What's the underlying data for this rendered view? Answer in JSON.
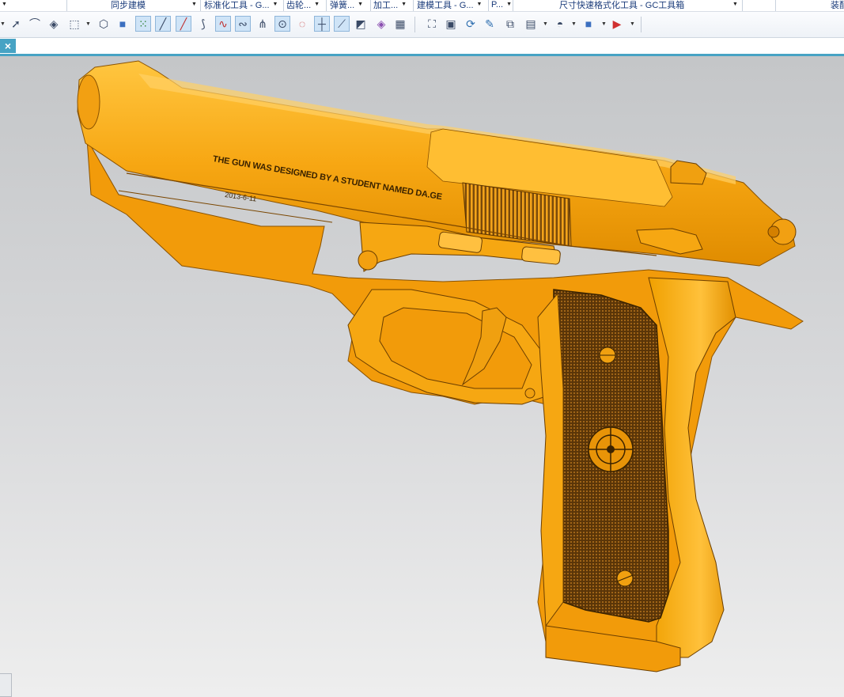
{
  "menu_groups": [
    {
      "label": "同步建模"
    },
    {
      "label": "标准化工具 - G..."
    },
    {
      "label": "齿轮..."
    },
    {
      "label": "弹簧..."
    },
    {
      "label": "加工..."
    },
    {
      "label": "建模工具 - G..."
    },
    {
      "label": "P..."
    },
    {
      "label": "尺寸快速格式化工具 - GC工具箱"
    },
    {
      "label": "装配"
    }
  ],
  "toolbar_icons": [
    "arrow-icon",
    "fillet-icon",
    "chamfer-icon",
    "shell-icon",
    "box-select-icon",
    "wireframe-icon",
    "shaded-icon",
    "point-snap-icon",
    "line-icon",
    "arc-icon",
    "curve-icon",
    "spline-icon",
    "wave-icon",
    "intersect-icon",
    "center-point-icon",
    "quadrant-icon",
    "cross-icon",
    "tangent-icon",
    "surface-icon",
    "mesh-icon",
    "table-icon",
    "view-fit-icon",
    "render-icon",
    "rotate-icon",
    "pen-icon",
    "section-icon",
    "layout-icon",
    "display-icon",
    "cube-view-icon",
    "filter-icon"
  ],
  "tab": {
    "close_label": "×"
  },
  "engraving": {
    "line1": "THE GUN WAS DESIGNED BY A STUDENT NAMED DA.GE",
    "line2": "2013-6-11"
  },
  "colors": {
    "body": "#f5a20d",
    "highlight": "#ffc13b",
    "shadow": "#c97a00",
    "grip": "#6b4414",
    "tab_accent": "#47a3c4"
  }
}
